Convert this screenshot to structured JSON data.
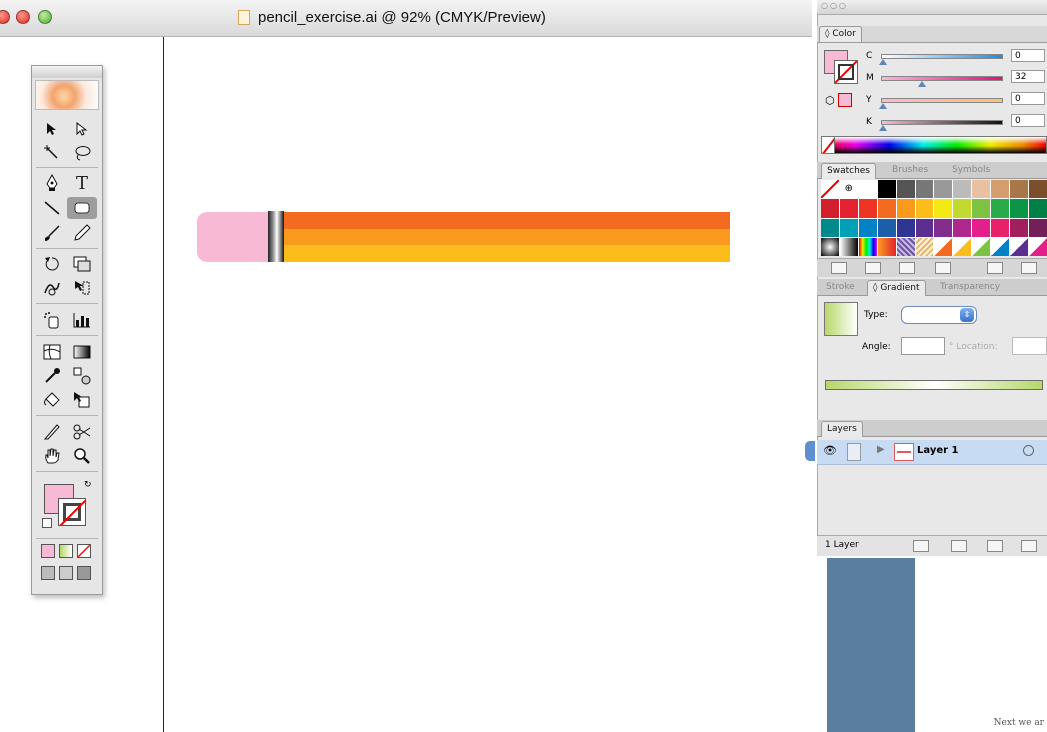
{
  "window": {
    "title": "pencil_exercise.ai @ 92% (CMYK/Preview)"
  },
  "artwork": {
    "colors": {
      "eraser": "#f8b9d5",
      "band_top": "#f26b20",
      "band_middle": "#f99a1d",
      "band_bottom": "#fcbd1a"
    }
  },
  "toolbox": {
    "tools": [
      "selection-tool",
      "direct-selection-tool",
      "magic-wand-tool",
      "lasso-tool",
      "pen-tool",
      "type-tool",
      "line-segment-tool",
      "rectangle-tool",
      "paintbrush-tool",
      "pencil-tool",
      "rotate-tool",
      "scale-tool",
      "warp-tool",
      "free-transform-tool",
      "symbol-sprayer-tool",
      "column-graph-tool",
      "mesh-tool",
      "gradient-tool",
      "eyedropper-tool",
      "blend-tool",
      "live-paint-bucket-tool",
      "live-paint-selection-tool",
      "slice-tool",
      "scissors-tool",
      "hand-tool",
      "zoom-tool"
    ],
    "type_glyph": "T",
    "fill_color": "#f8b9d5"
  },
  "color_panel": {
    "tab": "Color",
    "sliders": [
      {
        "label": "C",
        "value": "0"
      },
      {
        "label": "M",
        "value": "32"
      },
      {
        "label": "Y",
        "value": "0"
      },
      {
        "label": "K",
        "value": "0"
      }
    ]
  },
  "swatches_panel": {
    "tabs": [
      "Swatches",
      "Brushes",
      "Symbols"
    ]
  },
  "gradient_panel": {
    "tabs": [
      "Stroke",
      "Gradient",
      "Transparency"
    ],
    "type_label": "Type:",
    "type_value": "",
    "angle_label": "Angle:",
    "angle_value": "",
    "location_label": "Location:",
    "location_value": ""
  },
  "layers_panel": {
    "tab": "Layers",
    "layer_name": "Layer 1",
    "footer_count": "1 Layer"
  },
  "background_note": "Next we ar"
}
